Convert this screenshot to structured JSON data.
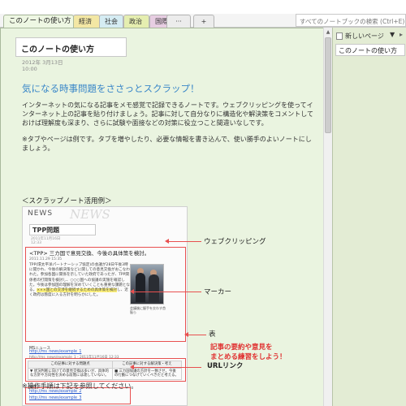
{
  "tabs": {
    "active": "このノートの使い方",
    "items": [
      "経済",
      "社会",
      "政治",
      "国際"
    ],
    "more": "···",
    "add": "+"
  },
  "search": {
    "placeholder": "すべてのノートブックの検索 (Ctrl+E)"
  },
  "page": {
    "title": "このノートの使い方",
    "date": "2012年 3月13日",
    "time": "10:00",
    "heading": "気になる時事問題をささっとスクラップ！",
    "paragraph1": "インターネットの気になる記事をメモ感覚で記録できるノートです。ウェブクリッピングを使ってインターネット上の記事を貼り付けましょう。記事に対して自分なりに構造化や解決策をコメントしておけば理解度も深まり、さらに試験や面接などの対策に役立つこと間違いなしです。",
    "paragraph2": "※タブやページは例です。タブを増やしたり、必要な情報を書き込んで、使い勝手のよいノートにしましょう。",
    "subhead": "＜スクラップノート活用例＞",
    "footer_note": "※操作手順は下記を参照してください。"
  },
  "scrap": {
    "news_label": "NEWS",
    "news_bg": "NEWS",
    "title": "TPP問題",
    "date": "2011年11月16日",
    "time": "12:33",
    "article_head": "<TPP> 三カ国で意見交換、今後の具体策を検討。",
    "article_date": "2011.11.29 15:35",
    "article_body": "TPP(環太平洋パートナーシップ協定)の会議が28日午後3時に開かれ、今後の解決策などに関しての意見交換がおこなわれた。参加各国に関係を示していた政府であったが、TPP関係者の打開策を検討し、○○○国への協議の実施を確認した。今後は参加国の理解を深めていくことも重要な課題となる。",
    "article_highlight": "×××国との交渉を継続するための具体策を検討",
    "article_tail": "し、近く政府は態度に入る方針を明らかにした。",
    "photo_caption": "会議後に握手を交わす首脳ら",
    "link_label_1": "MSニュース",
    "link_url_1": "http://ms_news/example_1",
    "link_note_1": "http://ms_news/example_1 - 2011年11月16日 12:33",
    "table_header_1": "この記事に対する問題点",
    "table_header_2": "この記事に対する解決策・考え",
    "table_cell_1": "▼ 状況判断に向けての意見交換は多いが、具体的な方針や方向性を決める段階には達していない。",
    "table_cell_2": "■ 三カ国協議の方針を一致させ、今後の行動につなげていくべきだと考える。",
    "link_label_2": "関連ニュース",
    "link_url_2": "http://ms_news/example_2",
    "link_url_3": "http://ms_news/example_3"
  },
  "annotations": {
    "web_clipping": "ウェブクリッピング",
    "marker": "マーカー",
    "table": "表",
    "summary_line1": "記事の要約や意見を",
    "summary_line2": "まとめる練習をしよう！",
    "url_link": "URLリンク"
  },
  "side_pane": {
    "new_page": "新しいページ",
    "arrow": "▼",
    "chevron": "▸",
    "pages": [
      "このノートの使い方"
    ]
  },
  "scrollbar": {
    "up_arrow": "▲"
  },
  "colors": {
    "accent_blue": "#3a87c8",
    "page_bg": "#eaf4e0",
    "annotation_red": "#e85050",
    "tab_keizai": "#f3e7a4",
    "tab_shakai": "#d5ecf3",
    "tab_seiji": "#e5eeb0",
    "tab_kokusai": "#e7cde2"
  }
}
